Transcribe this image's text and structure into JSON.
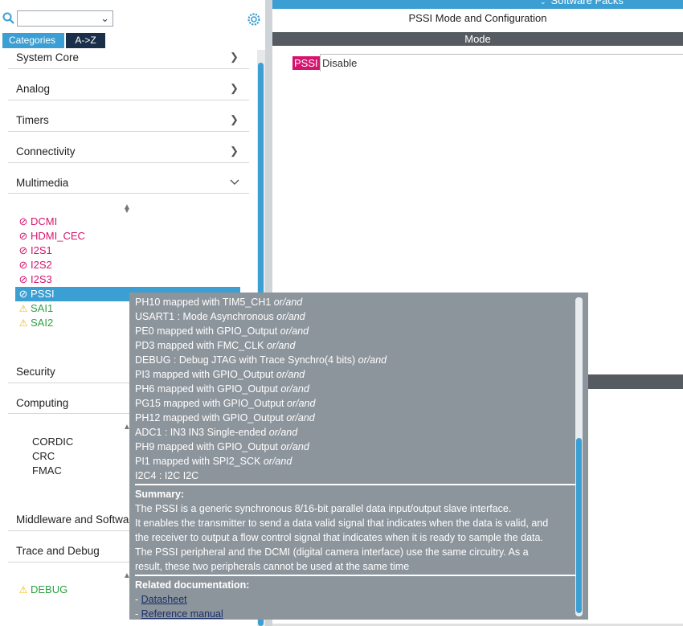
{
  "toolbar": {
    "search_value": "",
    "dropdown_icon": "chevron-down",
    "settings_icon": "gear"
  },
  "tabs": [
    {
      "label": "Categories"
    },
    {
      "label": "A->Z"
    }
  ],
  "categories": [
    {
      "label": "System Core",
      "state": "collapsed"
    },
    {
      "label": "Analog",
      "state": "collapsed"
    },
    {
      "label": "Timers",
      "state": "collapsed"
    },
    {
      "label": "Connectivity",
      "state": "collapsed"
    },
    {
      "label": "Multimedia",
      "state": "expanded"
    },
    {
      "label": "Security"
    },
    {
      "label": "Computing"
    },
    {
      "label": "Middleware and Software"
    },
    {
      "label": "Trace and Debug"
    }
  ],
  "multimedia_items": [
    {
      "label": "DCMI",
      "status": "disabled"
    },
    {
      "label": "HDMI_CEC",
      "status": "disabled"
    },
    {
      "label": "I2S1",
      "status": "disabled"
    },
    {
      "label": "I2S2",
      "status": "disabled"
    },
    {
      "label": "I2S3",
      "status": "disabled"
    },
    {
      "label": "PSSI",
      "status": "disabled",
      "selected": true
    },
    {
      "label": "SAI1",
      "status": "warning"
    },
    {
      "label": "SAI2",
      "status": "warning"
    }
  ],
  "computing_items": [
    {
      "label": "CORDIC"
    },
    {
      "label": "CRC"
    },
    {
      "label": "FMAC"
    }
  ],
  "debug_items": [
    {
      "label": "DEBUG",
      "status": "warning"
    }
  ],
  "right": {
    "topbar_text": "Software Packs",
    "title": "PSSI Mode and Configuration",
    "mode_header": "Mode",
    "pssi_tag": "PSSI",
    "pssi_value": "Disable"
  },
  "tooltip": {
    "lines": [
      {
        "text": "PH10 mapped with TIM5_CH1",
        "suffix": "or/and"
      },
      {
        "text": "USART1 : Mode Asynchronous",
        "suffix": "or/and"
      },
      {
        "text": "PE0 mapped with GPIO_Output",
        "suffix": "or/and"
      },
      {
        "text": "PD3 mapped with FMC_CLK",
        "suffix": "or/and"
      },
      {
        "text": "DEBUG : Debug JTAG with Trace Synchro(4 bits)",
        "suffix": "or/and"
      },
      {
        "text": "PI3 mapped with GPIO_Output",
        "suffix": "or/and"
      },
      {
        "text": "PH6 mapped with GPIO_Output",
        "suffix": "or/and"
      },
      {
        "text": "PG15 mapped with GPIO_Output",
        "suffix": "or/and"
      },
      {
        "text": "PH12 mapped with GPIO_Output",
        "suffix": "or/and"
      },
      {
        "text": "ADC1 : IN3 IN3 Single-ended",
        "suffix": "or/and"
      },
      {
        "text": "PH9 mapped with GPIO_Output",
        "suffix": "or/and"
      },
      {
        "text": "PI1 mapped with SPI2_SCK",
        "suffix": "or/and"
      },
      {
        "text": "I2C4 : I2C I2C",
        "suffix": ""
      }
    ],
    "summary_title": "Summary:",
    "summary_lines": [
      "The PSSI is a generic synchronous 8/16-bit parallel data input/output slave interface.",
      "It enables the transmitter to send a data valid signal that indicates when the data is valid, and",
      "the receiver to output a flow control signal that indicates when it is ready to sample the data.",
      "The PSSI peripheral and the DCMI (digital camera interface) use the same circuitry. As a",
      "result, these two peripherals cannot be used at the same time"
    ],
    "docs_title": "Related documentation:",
    "docs": [
      {
        "prefix": "- ",
        "label": "Datasheet "
      },
      {
        "prefix": "- ",
        "label": "Reference manual "
      }
    ]
  },
  "colors": {
    "accent": "#3c9fd3",
    "dark_tab": "#1a2f4a",
    "disabled": "#d4146e",
    "ok_warning_text": "#2ea043",
    "warning_icon": "#f2b705",
    "tooltip_bg": "#8d959c",
    "header_bar": "#555b60"
  }
}
